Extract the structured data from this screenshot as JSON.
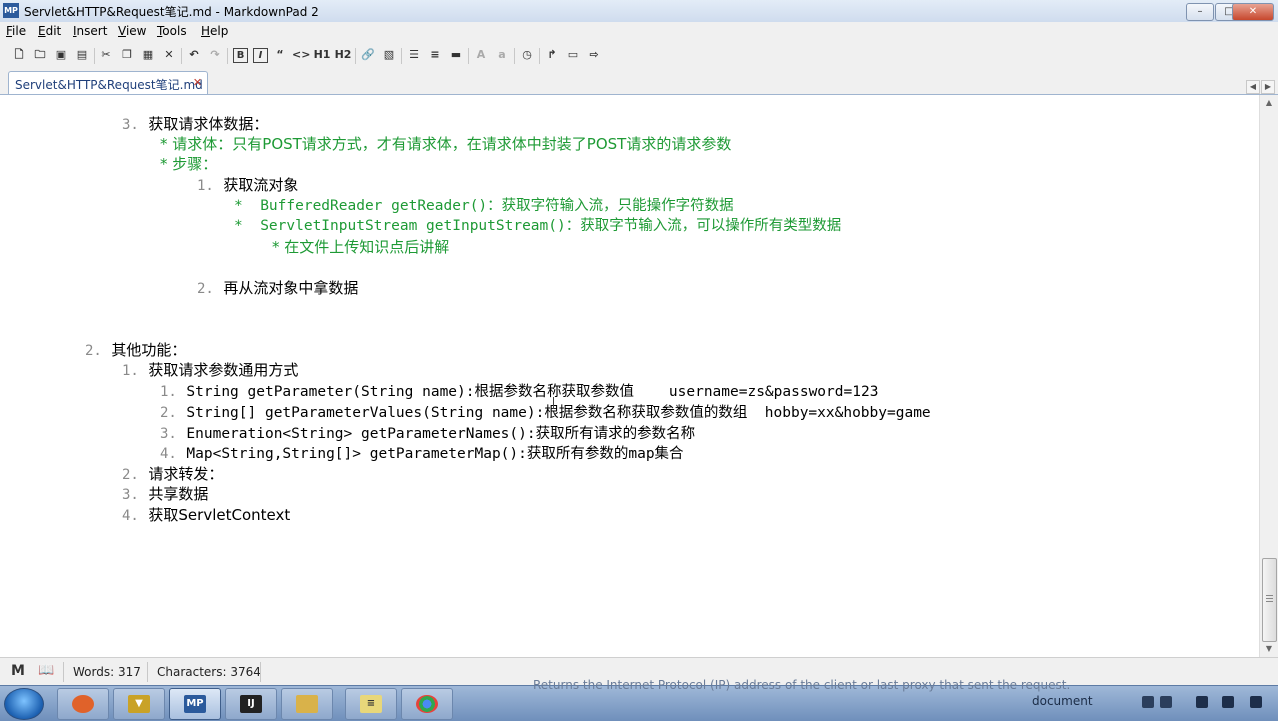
{
  "window": {
    "title": "Servlet&HTTP&Request笔记.md - MarkdownPad 2",
    "logo": "MP",
    "minimize": "–",
    "maximize": "□",
    "close": "✕"
  },
  "menu": {
    "items": [
      {
        "mnemonic": "F",
        "rest": "ile"
      },
      {
        "mnemonic": "E",
        "rest": "dit"
      },
      {
        "mnemonic": "I",
        "rest": "nsert"
      },
      {
        "mnemonic": "V",
        "rest": "iew"
      },
      {
        "mnemonic": "T",
        "rest": "ools"
      },
      {
        "mnemonic": "H",
        "rest": "elp"
      }
    ]
  },
  "toolbar": {
    "bold": "B",
    "italic": "I",
    "quote": "“",
    "code": "<>",
    "h1": "H1",
    "h2": "H2",
    "font_up": "A",
    "font_down": "a",
    "icons": [
      "new-file-icon",
      "open-folder-icon",
      "save-icon",
      "save-all-icon",
      "cut-icon",
      "copy-icon",
      "paste-icon",
      "delete-icon",
      "undo-icon",
      "redo-icon",
      "bold-icon",
      "italic-icon",
      "quote-icon",
      "code-icon",
      "h1-icon",
      "h2-icon",
      "link-icon",
      "image-icon",
      "bullet-list-icon",
      "numbered-list-icon",
      "horizontal-rule-icon",
      "font-increase-icon",
      "font-decrease-icon",
      "timestamp-icon",
      "export-icon",
      "preview-icon",
      "publish-icon"
    ]
  },
  "tab": {
    "label": "Servlet&HTTP&Request笔记.md",
    "close": "✕"
  },
  "editor": {
    "lines": [
      {
        "num": "3.",
        "text": "获取请求体数据：",
        "style": "normal"
      },
      {
        "num": "",
        "text": "* 请求体：只有POST请求方式，才有请求体，在请求体中封装了POST请求的请求参数",
        "style": "green"
      },
      {
        "num": "",
        "text": "* 步骤：",
        "style": "green"
      },
      {
        "num": "1.",
        "text": "获取流对象",
        "style": "normal"
      },
      {
        "num": "",
        "text": "*  BufferedReader getReader()：获取字符输入流，只能操作字符数据",
        "style": "green"
      },
      {
        "num": "",
        "text": "*  ServletInputStream getInputStream()：获取字节输入流，可以操作所有类型数据",
        "style": "green"
      },
      {
        "num": "",
        "text": "* 在文件上传知识点后讲解",
        "style": "green"
      },
      {
        "num": "2.",
        "text": "再从流对象中拿数据",
        "style": "normal"
      },
      {
        "num": "2.",
        "text": "其他功能：",
        "style": "normal"
      },
      {
        "num": "1.",
        "text": "获取请求参数通用方式",
        "style": "normal"
      },
      {
        "num": "1.",
        "text": "String getParameter(String name):根据参数名称获取参数值    username=zs&password=123",
        "style": "mono"
      },
      {
        "num": "2.",
        "text": "String[] getParameterValues(String name):根据参数名称获取参数值的数组  hobby=xx&hobby=game",
        "style": "mono"
      },
      {
        "num": "3.",
        "text": "Enumeration<String> getParameterNames():获取所有请求的参数名称",
        "style": "mono"
      },
      {
        "num": "4.",
        "text": "Map<String,String[]> getParameterMap():获取所有参数的map集合",
        "style": "mono"
      },
      {
        "num": "2.",
        "text": "请求转发：",
        "style": "normal"
      },
      {
        "num": "3.",
        "text": "共享数据",
        "style": "normal"
      },
      {
        "num": "4.",
        "text": "获取ServletContext",
        "style": "normal"
      }
    ]
  },
  "statusbar": {
    "markdown_icon": "M",
    "preview_icon": "📖",
    "words": "Words: 317",
    "characters": "Characters: 3764"
  },
  "taskbar": {
    "ghost_text": "Returns the Internet Protocol (IP) address of the client or last proxy that sent the request.",
    "items": [
      "windows-media-icon",
      "media-player-icon",
      "markdownpad-icon",
      "intellij-icon",
      "file-explorer-icon",
      "notepad-icon",
      "chrome-icon"
    ],
    "tray_label": "document"
  }
}
